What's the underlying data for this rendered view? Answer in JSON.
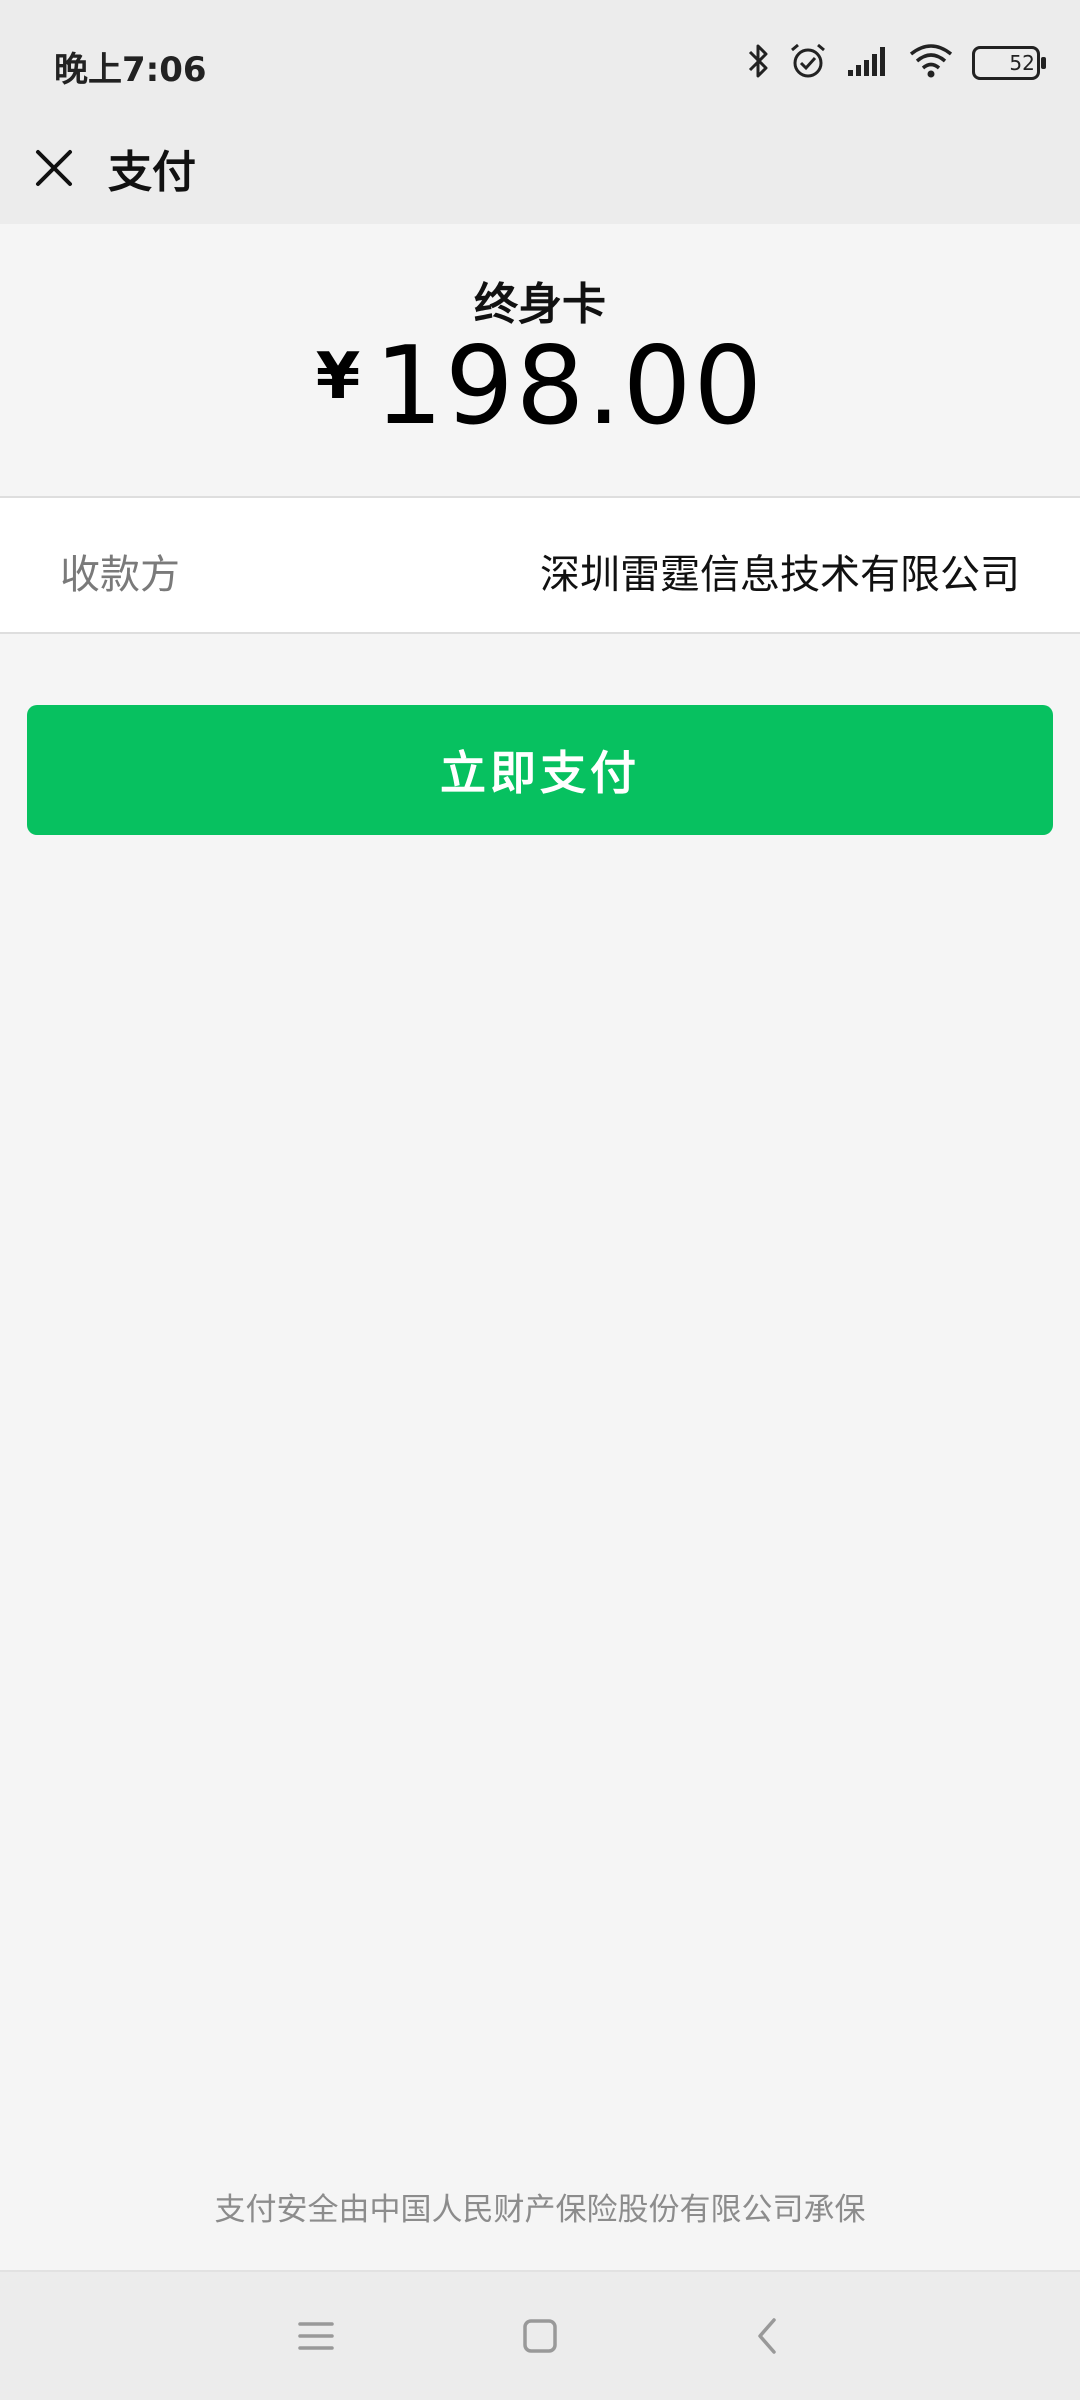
{
  "status_bar": {
    "time": "晚上7:06",
    "battery_level": "52",
    "icons": [
      "bluetooth-icon",
      "alarm-icon",
      "signal-icon",
      "wifi-icon",
      "battery-icon"
    ]
  },
  "nav": {
    "title": "支付",
    "close_icon": "close-icon"
  },
  "order": {
    "product_name": "终身卡",
    "currency": "¥",
    "amount": "198.00"
  },
  "payee": {
    "label": "收款方",
    "name": "深圳雷霆信息技术有限公司"
  },
  "pay_button": {
    "label": "立即支付",
    "color": "#07c160"
  },
  "footer": {
    "note": "支付安全由中国人民财产保险股份有限公司承保"
  },
  "system_nav": {
    "buttons": [
      "menu-icon",
      "home-icon",
      "back-icon"
    ]
  }
}
